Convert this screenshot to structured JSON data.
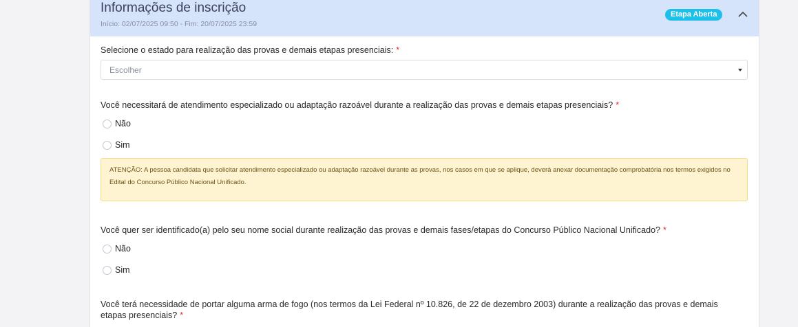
{
  "header": {
    "title": "Informações de inscrição",
    "subtitle": "Início: 02/07/2025 09:50 - Fim: 20/07/2025 23:59",
    "badge": "Etapa Aberta"
  },
  "q_estado": {
    "label": "Selecione o estado para realização das provas e demais etapas presenciais:",
    "required": "*",
    "select_value": "Escolher"
  },
  "q_atendimento": {
    "label": "Você necessitará de atendimento especializado ou adaptação razoável durante a realização das provas e demais etapas presenciais?",
    "required": "*",
    "options": [
      "Não",
      "Sim"
    ],
    "alert": "ATENÇÃO: A pessoa candidata que solicitar atendimento especializado ou adaptação razoável durante as provas, nos casos em que se aplique, deverá anexar documentação comprobatória nos termos exigidos no Edital do Concurso Público Nacional Unificado."
  },
  "q_nome_social": {
    "label": "Você quer ser identificado(a) pelo seu nome social durante realização das provas e demais fases/etapas do Concurso Público Nacional Unificado?",
    "required": "*",
    "options": [
      "Não",
      "Sim"
    ]
  },
  "q_arma": {
    "label": "Você terá necessidade de portar alguma arma de fogo (nos termos da Lei Federal nº 10.826, de 22 de dezembro 2003) durante a realização das provas e demais etapas presenciais?",
    "required": "*"
  },
  "colors": {
    "header_bg": "#d5e3fb",
    "badge_bg": "#1ec0ea",
    "required": "#e03131",
    "alert_bg": "#fff4d1"
  },
  "icons": {
    "collapse": "chevron-up-icon",
    "select_caret": "caret-down-icon"
  }
}
